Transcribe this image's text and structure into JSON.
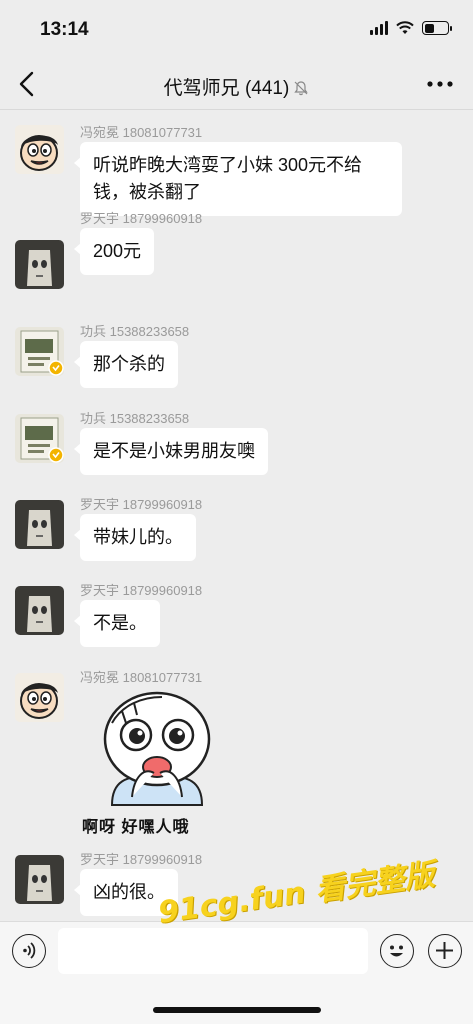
{
  "status_bar": {
    "time": "13:14"
  },
  "nav": {
    "title": "代驾师兄 (441)"
  },
  "messages": [
    {
      "sender": "冯宛冕 18081077731",
      "text": "听说昨晚大湾耍了小妹 300元不给钱，被杀翻了",
      "avatar": "cartoon-face-avatar"
    },
    {
      "sender": "罗天宇  18799960918",
      "text": "200元",
      "avatar": "mask-face-avatar"
    },
    {
      "sender": "功兵 15388233658",
      "text": "那个杀的",
      "avatar": "poster-avatar"
    },
    {
      "sender": "功兵 15388233658",
      "text": "是不是小妹男朋友噢",
      "avatar": "poster-avatar"
    },
    {
      "sender": "罗天宇  18799960918",
      "text": "带妹儿的。",
      "avatar": "mask-face-avatar"
    },
    {
      "sender": "罗天宇  18799960918",
      "text": "不是。",
      "avatar": "mask-face-avatar"
    },
    {
      "sender": "冯宛冕 18081077731",
      "sticker_caption": "啊呀 好嘿人哦",
      "avatar": "cartoon-face-avatar"
    },
    {
      "sender": "罗天宇  18799960918",
      "text": "凶的很。",
      "avatar": "mask-face-avatar"
    }
  ],
  "input": {
    "placeholder": ""
  },
  "watermark": "91cg.fun 看完整版",
  "colors": {
    "background": "#ededed",
    "bubble": "#ffffff",
    "sender_text": "#9a9a9a",
    "watermark": "#f7d21e"
  },
  "icons": [
    "back-icon",
    "mute-icon",
    "more-icon",
    "voice-icon",
    "emoji-icon",
    "plus-icon"
  ]
}
